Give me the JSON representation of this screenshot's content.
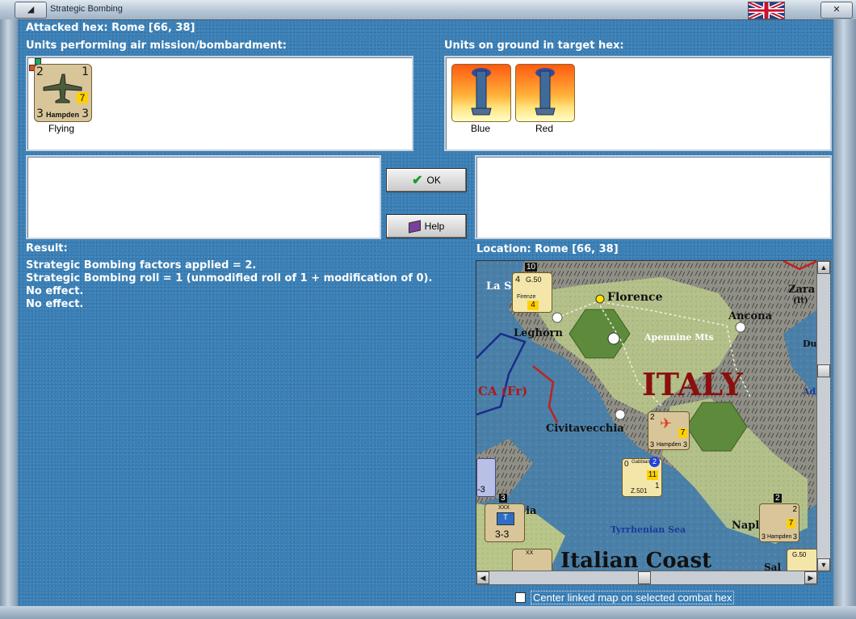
{
  "window": {
    "title": "Strategic Bombing",
    "minimize_glyph": "◢",
    "close_glyph": "✕",
    "flag_icon": "uk-flag-icon"
  },
  "attacked_hex": "Attacked hex: Rome  [66, 38]",
  "air_units": {
    "header": "Units performing air mission/bombardment:",
    "items": [
      {
        "name": "Hampden",
        "status": "Flying",
        "top_left": "2",
        "top_right": "1",
        "bottom_left": "3",
        "bottom_right": "3",
        "factor": "7"
      }
    ]
  },
  "ground_units": {
    "header": "Units on ground in target hex:",
    "items": [
      {
        "label": "Blue",
        "icon": "factory-smokestack-icon"
      },
      {
        "label": "Red",
        "icon": "factory-smokestack-icon"
      }
    ]
  },
  "buttons": {
    "ok": "OK",
    "help": "Help"
  },
  "result": {
    "header": "Result:",
    "lines": [
      "Strategic Bombing factors applied = 2.",
      "Strategic Bombing roll = 1 (unmodified roll of 1 + modification of 0).",
      "No effect.",
      "No effect."
    ]
  },
  "location": "Location:  Rome  [66, 38]",
  "map": {
    "labels": {
      "florence": "Florence",
      "ancona": "Ancona",
      "leghorn": "Leghorn",
      "apennine": "Apennine Mts",
      "italy": "ITALY",
      "corsica": "CA (Fr)",
      "civitavecchia": "Civitavecchia",
      "tyrrhenian": "Tyrrhenian Sea",
      "naples": "Napl",
      "coast": "Italian Coast",
      "la_spezia": "La S",
      "zara": "Zara",
      "zara_sub": "(It)",
      "bia": "bia",
      "du": "Du",
      "ad": "Ad",
      "sal": "Sal"
    },
    "counters": {
      "g50_top": {
        "type": "G.50",
        "base": "Firenze",
        "left": "4",
        "value": "4",
        "stack": "10"
      },
      "hampden_map": {
        "name": "Hampden",
        "top_left": "2",
        "bottom_left": "3",
        "bottom_right": "3",
        "factor": "7"
      },
      "z501": {
        "name": "Z.501",
        "base": "Gabbiani",
        "left": "0",
        "value": "11",
        "right": "1",
        "badge": "2"
      },
      "corps": {
        "size": "XXX",
        "value": "3-3",
        "stack": "3"
      },
      "hampden_naples": {
        "name": "Hampden",
        "top_right": "2",
        "bottom_left": "3",
        "bottom_right": "3",
        "factor": "7",
        "stack": "2"
      },
      "g50_bottom": {
        "type": "G.50"
      },
      "left_unit": {
        "value": "-3"
      },
      "bottom_corps": {
        "size": "XX"
      }
    }
  },
  "center_checkbox": {
    "label": "Center linked map on selected combat hex",
    "checked": false
  }
}
